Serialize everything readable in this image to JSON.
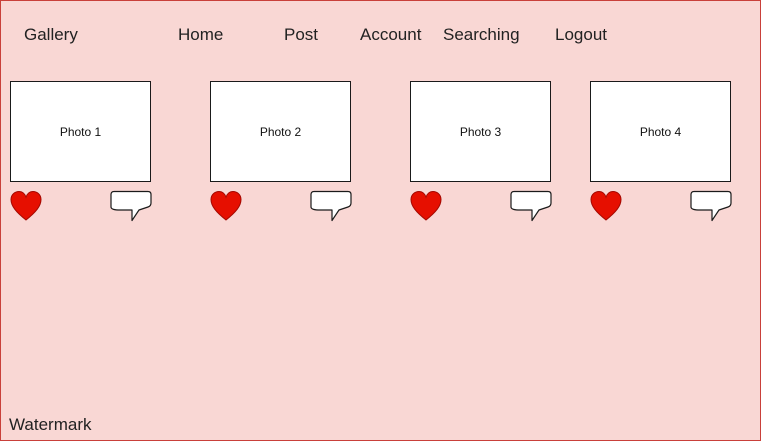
{
  "nav": {
    "brand": "Gallery",
    "home": "Home",
    "post": "Post",
    "account": "Account",
    "searching": "Searching",
    "logout": "Logout"
  },
  "photos": [
    {
      "label": "Photo 1"
    },
    {
      "label": "Photo 2"
    },
    {
      "label": "Photo 3"
    },
    {
      "label": "Photo 4"
    }
  ],
  "icons": {
    "like": "heart-icon",
    "comment": "speech-bubble-icon"
  },
  "colors": {
    "background": "#f9d7d4",
    "heart": "#e60f00",
    "border": "#c9403a"
  },
  "footer": {
    "watermark": "Watermark"
  }
}
